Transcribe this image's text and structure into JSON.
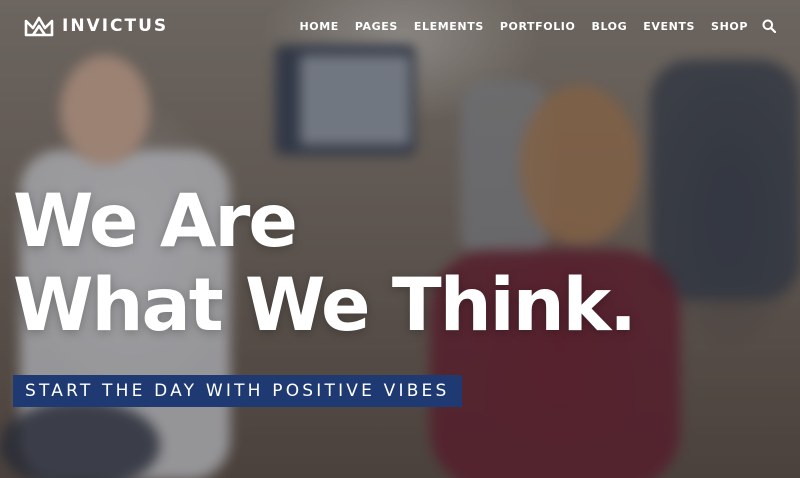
{
  "brand": {
    "name": "INVICTUS",
    "logo_icon": "invictus-crown-logo"
  },
  "nav": {
    "items": [
      {
        "label": "HOME"
      },
      {
        "label": "PAGES"
      },
      {
        "label": "ELEMENTS"
      },
      {
        "label": "PORTFOLIO"
      },
      {
        "label": "BLOG"
      },
      {
        "label": "EVENTS"
      },
      {
        "label": "SHOP"
      }
    ],
    "search_icon": "search-icon"
  },
  "hero": {
    "headline_line1": "We Are",
    "headline_line2": "What We Think.",
    "tagline": "START THE DAY WITH POSITIVE VIBES",
    "tagline_bg": "#1f3a72"
  }
}
